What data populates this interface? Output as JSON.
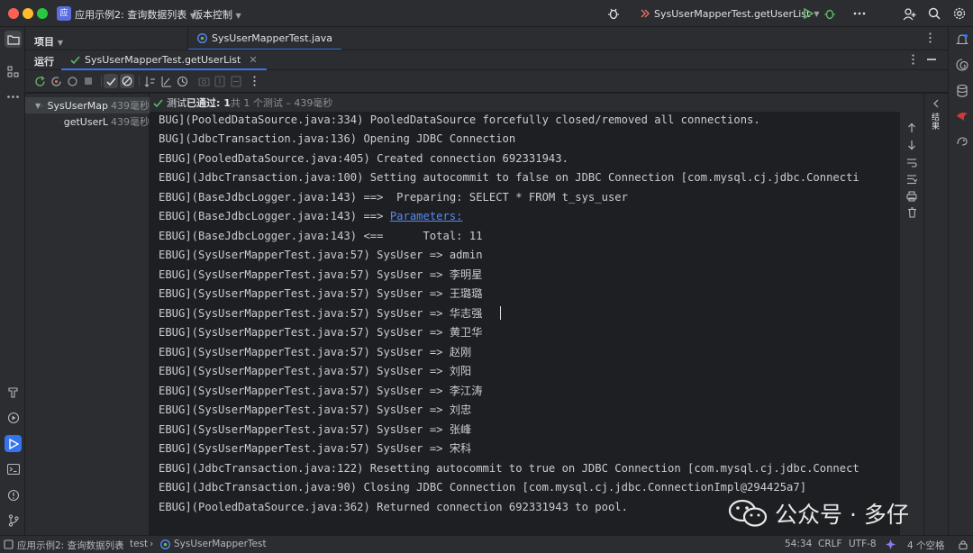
{
  "titlebar": {
    "project_badge": "应",
    "project_name": "应用示例2: 查询数据列表",
    "vcs_menu": "版本控制",
    "run_config": "SysUserMapperTest.getUserList"
  },
  "project_panel": {
    "title": "项目"
  },
  "editor": {
    "tab_label": "SysUserMapperTest.java"
  },
  "run_window": {
    "title": "运行",
    "tab_label": "SysUserMapperTest.getUserList"
  },
  "test_tree": {
    "root": {
      "name": "SysUserMap",
      "time": "439毫秒"
    },
    "child": {
      "name": "getUserL",
      "time": "439毫秒"
    }
  },
  "test_status": {
    "prefix": "测试 ",
    "bold": "已通过: 1",
    "summary": "共 1 个测试 – 439毫秒"
  },
  "console": {
    "lines": [
      "BUG](PooledDataSource.java:334) PooledDataSource forcefully closed/removed all connections.",
      "BUG](JdbcTransaction.java:136) Opening JDBC Connection",
      "EBUG](PooledDataSource.java:405) Created connection 692331943.",
      "EBUG](JdbcTransaction.java:100) Setting autocommit to false on JDBC Connection [com.mysql.cj.jdbc.Connecti",
      "EBUG](BaseJdbcLogger.java:143) ==>  Preparing: SELECT * FROM t_sys_user",
      "EBUG](BaseJdbcLogger.java:143) ==> ",
      "EBUG](BaseJdbcLogger.java:143) <==      Total: 11",
      "EBUG](SysUserMapperTest.java:57) SysUser => admin",
      "EBUG](SysUserMapperTest.java:57) SysUser => 李明星",
      "EBUG](SysUserMapperTest.java:57) SysUser => 王璐璐",
      "EBUG](SysUserMapperTest.java:57) SysUser => 华志强",
      "EBUG](SysUserMapperTest.java:57) SysUser => 黄卫华",
      "EBUG](SysUserMapperTest.java:57) SysUser => 赵刚",
      "EBUG](SysUserMapperTest.java:57) SysUser => 刘阳",
      "EBUG](SysUserMapperTest.java:57) SysUser => 李江涛",
      "EBUG](SysUserMapperTest.java:57) SysUser => 刘忠",
      "EBUG](SysUserMapperTest.java:57) SysUser => 张峰",
      "EBUG](SysUserMapperTest.java:57) SysUser => 宋科",
      "EBUG](JdbcTransaction.java:122) Resetting autocommit to true on JDBC Connection [com.mysql.cj.jdbc.Connect",
      "EBUG](JdbcTransaction.java:90) Closing JDBC Connection [com.mysql.cj.jdbc.ConnectionImpl@294425a7]",
      "EBUG](PooledDataSource.java:362) Returned connection 692331943 to pool."
    ],
    "parameters_link": "Parameters:"
  },
  "right_strip": {
    "vertical_label": "结果"
  },
  "statusbar": {
    "crumb_project": "应用示例2: 查询数据列表",
    "crumb_sep1": "›",
    "crumb_test": "test",
    "crumb_sep2": "›",
    "crumb_class": "SysUserMapperTest",
    "position": "54:34",
    "line_ending": "CRLF",
    "encoding": "UTF-8",
    "indent": "4 个空格"
  },
  "watermark": {
    "text": "公众号 · 多仔"
  },
  "colors": {
    "accent": "#3574f0",
    "pass": "#5fb865",
    "link": "#548af7"
  }
}
